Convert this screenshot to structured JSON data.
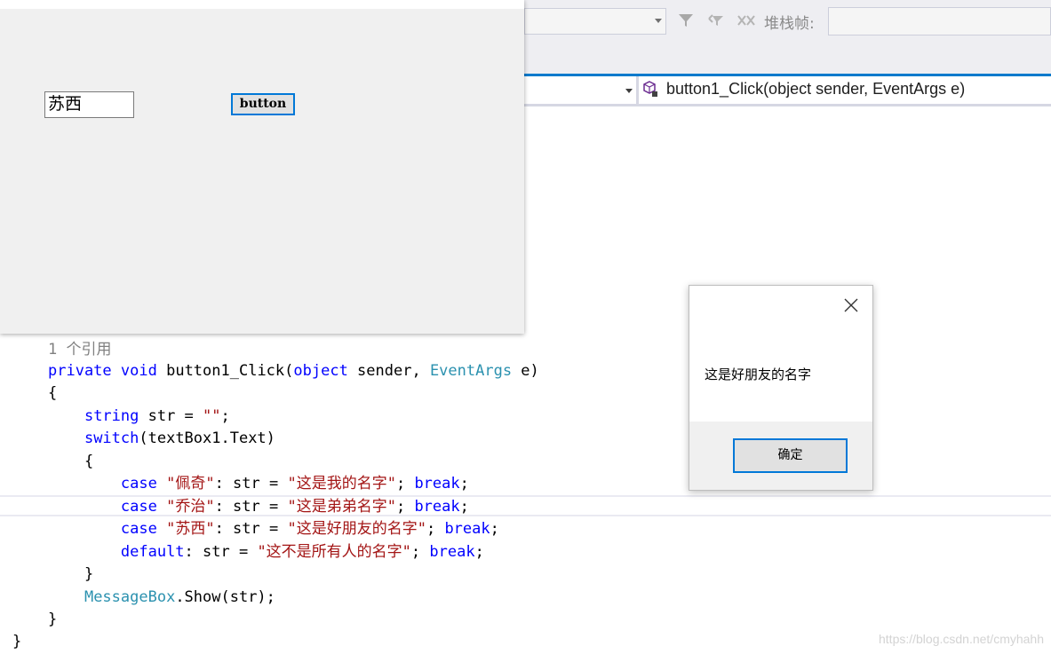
{
  "ide": {
    "stack_frame_label": "堆栈帧:",
    "nav_method": "button1_Click(object sender, EventArgs e)"
  },
  "code": {
    "references": "1 个引用",
    "lines": [
      [
        {
          "t": "private",
          "c": "kw"
        },
        {
          "t": " ",
          "c": "plain"
        },
        {
          "t": "void",
          "c": "kw"
        },
        {
          "t": " button1_Click(",
          "c": "plain"
        },
        {
          "t": "object",
          "c": "kw"
        },
        {
          "t": " sender, ",
          "c": "plain"
        },
        {
          "t": "EventArgs",
          "c": "ty"
        },
        {
          "t": " e)",
          "c": "plain"
        }
      ],
      [
        {
          "t": "{",
          "c": "plain"
        }
      ],
      [
        {
          "t": "    ",
          "c": "plain"
        },
        {
          "t": "string",
          "c": "kw"
        },
        {
          "t": " str = ",
          "c": "plain"
        },
        {
          "t": "\"\"",
          "c": "str"
        },
        {
          "t": ";",
          "c": "plain"
        }
      ],
      [
        {
          "t": "    ",
          "c": "plain"
        },
        {
          "t": "switch",
          "c": "kw"
        },
        {
          "t": "(textBox1.Text)",
          "c": "plain"
        }
      ],
      [
        {
          "t": "    {",
          "c": "plain"
        }
      ],
      [
        {
          "t": "        ",
          "c": "plain"
        },
        {
          "t": "case",
          "c": "kw"
        },
        {
          "t": " ",
          "c": "plain"
        },
        {
          "t": "\"佩奇\"",
          "c": "str"
        },
        {
          "t": ": str = ",
          "c": "plain"
        },
        {
          "t": "\"这是我的名字\"",
          "c": "str"
        },
        {
          "t": "; ",
          "c": "plain"
        },
        {
          "t": "break",
          "c": "kw"
        },
        {
          "t": ";",
          "c": "plain"
        }
      ],
      [
        {
          "t": "        ",
          "c": "plain"
        },
        {
          "t": "case",
          "c": "kw"
        },
        {
          "t": " ",
          "c": "plain"
        },
        {
          "t": "\"乔治\"",
          "c": "str"
        },
        {
          "t": ": str = ",
          "c": "plain"
        },
        {
          "t": "\"这是弟弟名字\"",
          "c": "str"
        },
        {
          "t": "; ",
          "c": "plain"
        },
        {
          "t": "break",
          "c": "kw"
        },
        {
          "t": ";",
          "c": "plain"
        }
      ],
      [
        {
          "t": "        ",
          "c": "plain"
        },
        {
          "t": "case",
          "c": "kw"
        },
        {
          "t": " ",
          "c": "plain"
        },
        {
          "t": "\"苏西\"",
          "c": "str"
        },
        {
          "t": ": str = ",
          "c": "plain"
        },
        {
          "t": "\"这是好朋友的名字\"",
          "c": "str"
        },
        {
          "t": "; ",
          "c": "plain"
        },
        {
          "t": "break",
          "c": "kw"
        },
        {
          "t": ";",
          "c": "plain"
        }
      ],
      [
        {
          "t": "        ",
          "c": "plain"
        },
        {
          "t": "default",
          "c": "kw"
        },
        {
          "t": ": str = ",
          "c": "plain"
        },
        {
          "t": "\"这不是所有人的名字\"",
          "c": "str"
        },
        {
          "t": "; ",
          "c": "plain"
        },
        {
          "t": "break",
          "c": "kw"
        },
        {
          "t": ";",
          "c": "plain"
        }
      ],
      [
        {
          "t": "    }",
          "c": "plain"
        }
      ],
      [
        {
          "t": "    ",
          "c": "plain"
        },
        {
          "t": "MessageBox",
          "c": "ty"
        },
        {
          "t": ".Show(str);",
          "c": "plain"
        }
      ],
      [
        {
          "t": "}",
          "c": "plain"
        }
      ],
      [
        {
          "t": "}",
          "c": "plain"
        }
      ]
    ]
  },
  "form": {
    "textbox_value": "苏西",
    "button_label": "button"
  },
  "messagebox": {
    "text": "这是好朋友的名字",
    "ok_label": "确定"
  },
  "watermark": "https://blog.csdn.net/cmyhahh",
  "colors": {
    "accent": "#007acc",
    "keyword": "#0000ff",
    "type": "#2b91af",
    "string": "#a31515"
  }
}
